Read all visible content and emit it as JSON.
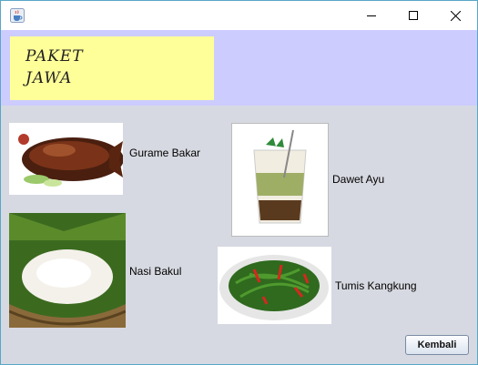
{
  "window": {
    "title": ""
  },
  "banner": {
    "line1": "PAKET",
    "line2": "JAWA"
  },
  "menu": [
    {
      "label": "Gurame Bakar"
    },
    {
      "label": "Dawet Ayu"
    },
    {
      "label": "Nasi Bakul"
    },
    {
      "label": "Tumis Kangkung"
    }
  ],
  "buttons": {
    "back": "Kembali"
  },
  "colors": {
    "header": "#ccccff",
    "banner": "#ffff99",
    "content_bg": "#d6d9e1",
    "border": "#59a6c7"
  },
  "icons": {
    "app": "java-coffee-cup-icon",
    "minimize": "minimize-icon",
    "maximize": "maximize-icon",
    "close": "close-icon"
  }
}
